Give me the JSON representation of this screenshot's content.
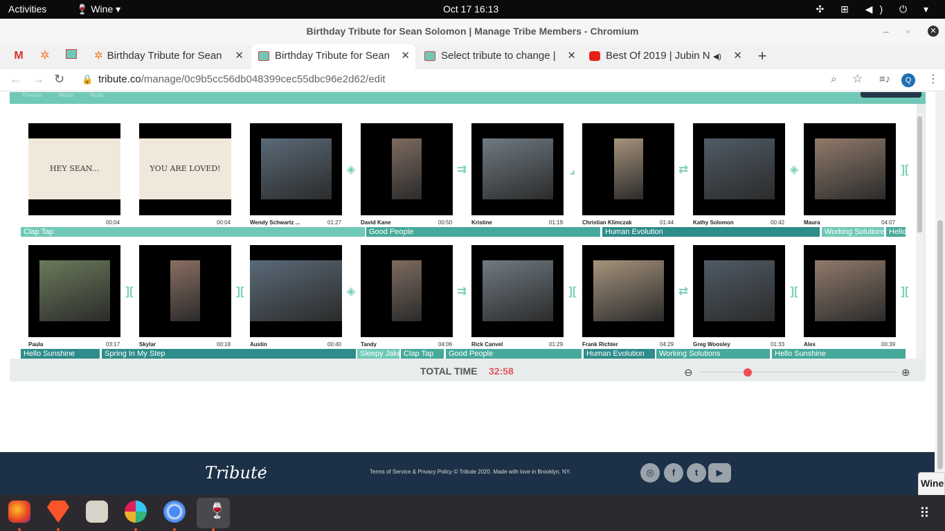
{
  "system": {
    "activities": "Activities",
    "app": "Wine",
    "clock": "Oct 17  16:13"
  },
  "window": {
    "title": "Birthday Tribute for Sean Solomon | Manage Tribe Members - Chromium"
  },
  "tabs": [
    {
      "label": "Birthday Tribute for Sean",
      "icon": "tribute-favicon"
    },
    {
      "label": "Birthday Tribute for Sean",
      "icon": "tribute-favicon"
    },
    {
      "label": "Select tribute to change |",
      "icon": "tribute-favicon"
    },
    {
      "label": "Best Of 2019 | Jubin N",
      "icon": "youtube-favicon"
    }
  ],
  "browser": {
    "url_host": "tribute.co",
    "url_path": "/manage/0c9b5cc56db048399cec55dbc96e2d62/edit",
    "profile": "Q"
  },
  "editor_tabs": [
    "Preview",
    "Media",
    "Music"
  ],
  "row1": [
    {
      "name": "",
      "dur": "00:04",
      "slide": "HEY SEAN..."
    },
    {
      "name": "",
      "dur": "00:04",
      "slide": "YOU ARE LOVED!"
    },
    {
      "name": "Wendy Schwartz ...",
      "dur": "01:27"
    },
    {
      "name": "David Kane",
      "dur": "00:50"
    },
    {
      "name": "Kristine",
      "dur": "01:19"
    },
    {
      "name": "Christian Klimczak",
      "dur": "01:44"
    },
    {
      "name": "Kathy Solomon",
      "dur": "00:42"
    },
    {
      "name": "Maura",
      "dur": "04:07"
    }
  ],
  "row2": [
    {
      "name": "Paula",
      "dur": "03:17"
    },
    {
      "name": "Skylar",
      "dur": "00:18"
    },
    {
      "name": "Austin",
      "dur": "00:40"
    },
    {
      "name": "Tandy",
      "dur": "04:06"
    },
    {
      "name": "Rick Canvel",
      "dur": "01:29"
    },
    {
      "name": "Frank Richter",
      "dur": "04:29"
    },
    {
      "name": "Greg Woosley",
      "dur": "01:33"
    },
    {
      "name": "Alex",
      "dur": "00:39"
    }
  ],
  "music1": [
    "Clap Tap",
    "Good People",
    "Human Evolution",
    "Working Solutions",
    "Hello"
  ],
  "music2": [
    "Hello Sunshine",
    "Spring In My Step",
    "Sleepy Jake",
    "Clap Tap",
    "Good People",
    "Human Evolution",
    "Working Solutions",
    "Hello Sunshine"
  ],
  "total": {
    "label": "TOTAL TIME",
    "value": "32:58"
  },
  "footer": {
    "logo": "Tribute",
    "legal": "Terms of Service & Privacy Policy © Tribute 2020. Made with love in Brooklyn, NY."
  },
  "popup": "Wine"
}
